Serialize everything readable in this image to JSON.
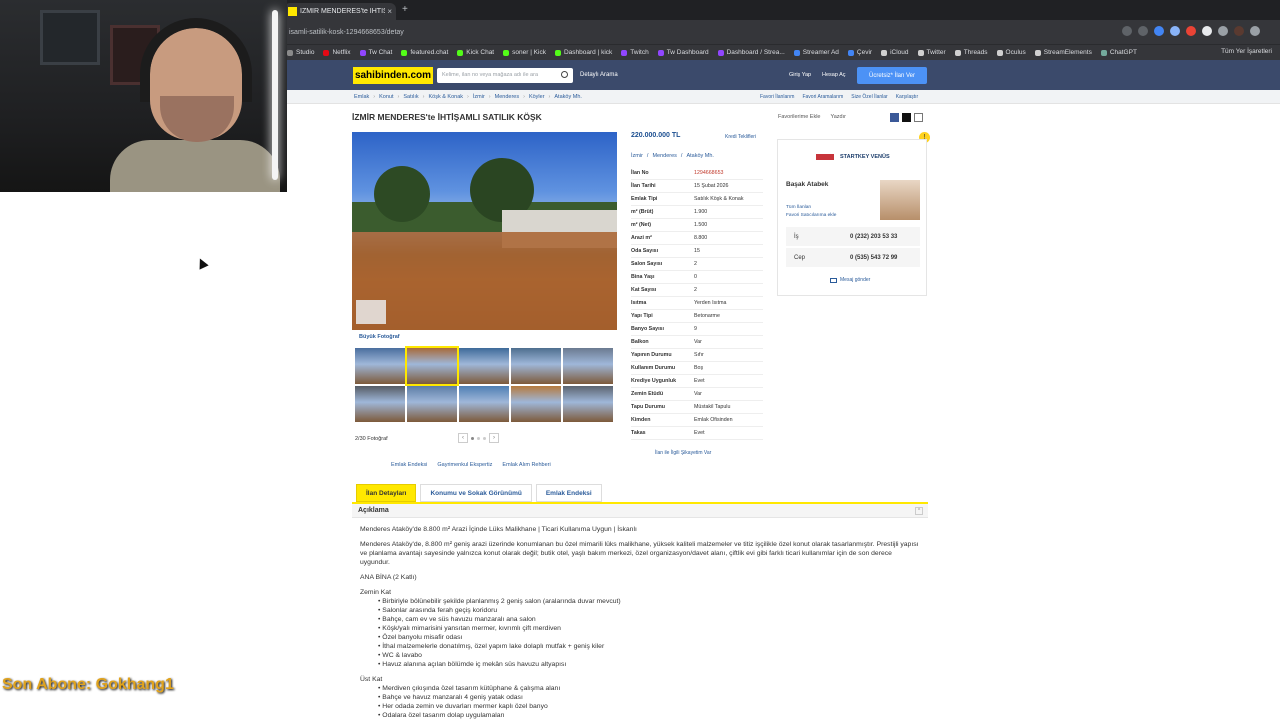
{
  "overlay": {
    "subscriber_text": "Son Abone: Gokhang1"
  },
  "browser": {
    "tab_title": "İZMİR MENDERES'te İHTİŞAMLI SATILIK KÖŞK",
    "url": "isamli-satilik-kosk-1294668653/detay",
    "bookmarks": [
      "Studio",
      "Netflix",
      "Tw Chat",
      "featured.chat",
      "Kick Chat",
      "soner | Kick",
      "Dashboard | kick",
      "Twitch",
      "Tw Dashboard",
      "Dashboard / Strea...",
      "Streamer Ad",
      "Çevir",
      "iCloud",
      "Twitter",
      "Threads",
      "Oculus",
      "StreamElements",
      "ChatGPT"
    ],
    "bookmark_colors": [
      "#8a8a8a",
      "#e50914",
      "#9146ff",
      "#53fc18",
      "#53fc18",
      "#53fc18",
      "#53fc18",
      "#9146ff",
      "#9146ff",
      "#9146ff",
      "#4285f4",
      "#4285f4",
      "#d0d0d0",
      "#d0d0d0",
      "#d0d0d0",
      "#d0d0d0",
      "#d0d0d0",
      "#74aa9c"
    ],
    "bookmarks_right": "Tüm Yer İşaretleri"
  },
  "site": {
    "logo": "sahibinden.com",
    "search_placeholder": "Kelime, ilan no veya mağaza adı ile ara",
    "detailed_search": "Detaylı Arama",
    "login": "Giriş Yap",
    "register": "Hesap Aç",
    "post_button": "Ücretsiz* İlan Ver",
    "breadcrumbs": [
      "Emlak",
      "Konut",
      "Satılık",
      "Köşk & Konak",
      "İzmir",
      "Menderes",
      "Köyler",
      "Ataköy Mh."
    ],
    "crumb_links": [
      "Favori İlanlarım",
      "Favori Aramalarım",
      "Size Özel İlanlar",
      "Karşılaştır"
    ]
  },
  "listing": {
    "title": "İZMİR MENDERES'te İHTİŞAMLI SATILIK KÖŞK",
    "actions": [
      "Favorilerime Ekle",
      "Yazdır"
    ],
    "price": "220.000.000 TL",
    "credit_link": "Kredi Teklifleri",
    "location": [
      "İzmir",
      "Menderes",
      "Ataköy Mh."
    ],
    "photo_tabs": [
      "Büyük Fotoğraf"
    ],
    "photo_counter": "2/30 Fotoğraf",
    "details": [
      {
        "k": "İlan No",
        "v": "1294668653"
      },
      {
        "k": "İlan Tarihi",
        "v": "15 Şubat 2026"
      },
      {
        "k": "Emlak Tipi",
        "v": "Satılık Köşk & Konak"
      },
      {
        "k": "m² (Brüt)",
        "v": "1.900"
      },
      {
        "k": "m² (Net)",
        "v": "1.500"
      },
      {
        "k": "Arazi m²",
        "v": "8.800"
      },
      {
        "k": "Oda Sayısı",
        "v": "15"
      },
      {
        "k": "Salon Sayısı",
        "v": "2"
      },
      {
        "k": "Bina Yaşı",
        "v": "0"
      },
      {
        "k": "Kat Sayısı",
        "v": "2"
      },
      {
        "k": "Isıtma",
        "v": "Yerden Isıtma"
      },
      {
        "k": "Yapı Tipi",
        "v": "Betonarme"
      },
      {
        "k": "Banyo Sayısı",
        "v": "9"
      },
      {
        "k": "Balkon",
        "v": "Var"
      },
      {
        "k": "Yapının Durumu",
        "v": "Sıfır"
      },
      {
        "k": "Kullanım Durumu",
        "v": "Boş"
      },
      {
        "k": "Krediye Uygunluk",
        "v": "Evet"
      },
      {
        "k": "Zemin Etüdü",
        "v": "Var"
      },
      {
        "k": "Tapu Durumu",
        "v": "Müstakil Tapulu"
      },
      {
        "k": "Kimden",
        "v": "Emlak Ofisinden"
      },
      {
        "k": "Takas",
        "v": "Evet"
      }
    ],
    "complaint": "İlan ile İlgili Şikayetim Var",
    "bottom_links": [
      "Emlak Endeksi",
      "Gayrimenkul Ekspertiz",
      "Emlak Alım Rehberi"
    ]
  },
  "agent": {
    "agency": "STARTKEY VENÜS",
    "name": "Başak Atabek",
    "links": [
      "Tüm İlanları",
      "Favori Satıcılarıma ekle"
    ],
    "phones": [
      {
        "label": "İş",
        "number": "0 (232) 203 53 33"
      },
      {
        "label": "Cep",
        "number": "0 (535) 543 72 99"
      }
    ],
    "message": "Mesaj gönder"
  },
  "tabs": [
    "İlan Detayları",
    "Konumu ve Sokak Görünümü",
    "Emlak Endeksi"
  ],
  "description": {
    "header": "Açıklama",
    "headline": "Menderes Ataköy'de 8.800 m² Arazi İçinde Lüks Malikhane | Ticari Kullanıma Uygun | İskanlı",
    "intro": "Menderes Ataköy'de, 8.800 m² geniş arazi üzerinde konumlanan bu özel mimarili lüks malikhane, yüksek kaliteli malzemeler ve titiz işçilikle özel konut olarak tasarlanmıştır. Prestijli yapısı ve planlama avantajı sayesinde yalnızca konut olarak değil; butik otel, yaşlı bakım merkezi, özel organizasyon/davet alanı, çiftlik evi gibi farklı ticari kullanımlar için de son derece uygundur.",
    "section": "ANA BİNA (2 Katlı)",
    "ground_title": "Zemin Kat",
    "ground_items": [
      "Birbiriyle bölünebilir şekilde planlanmış 2 geniş salon (aralarında duvar mevcut)",
      "Salonlar arasında ferah geçiş koridoru",
      "Bahçe, cam ev ve süs havuzu manzaralı ana salon",
      "Köşk/yalı mimarisini yansıtan mermer, kıvrımlı çift merdiven",
      "Özel banyolu misafir odası",
      "İthal malzemelerle donatılmış, özel yapım lake dolaplı mutfak + geniş kiler",
      "WC & lavabo",
      "Havuz alanına açılan bölümde iç mekân süs havuzu altyapısı"
    ],
    "upper_title": "Üst Kat",
    "upper_items": [
      "Merdiven çıkışında özel tasarım kütüphane & çalışma alanı",
      "Bahçe ve havuz manzaralı 4 geniş yatak odası",
      "Her odada zemin ve duvarları mermer kaplı özel banyo",
      "Odalara özel tasarım dolap uygulamaları"
    ]
  }
}
